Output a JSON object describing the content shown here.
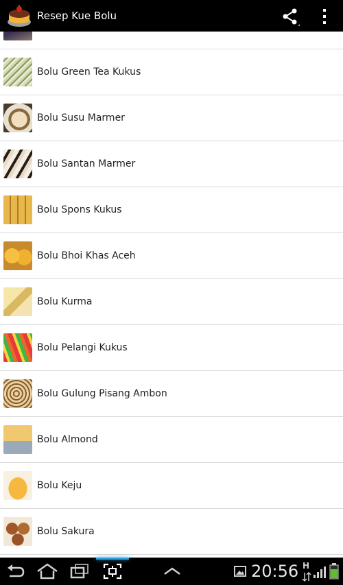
{
  "actionbar": {
    "title": "Resep Kue Bolu",
    "icons": {
      "app": "cake-icon",
      "share": "share-icon",
      "overflow": "more-vert-icon"
    }
  },
  "recipes": [
    {
      "label": "",
      "thumb": "partial-thumbnail"
    },
    {
      "label": "Bolu Green Tea Kukus"
    },
    {
      "label": "Bolu Susu Marmer"
    },
    {
      "label": "Bolu Santan Marmer"
    },
    {
      "label": "Bolu Spons Kukus"
    },
    {
      "label": "Bolu Bhoi Khas Aceh"
    },
    {
      "label": "Bolu Kurma"
    },
    {
      "label": "Bolu Pelangi Kukus"
    },
    {
      "label": "Bolu Gulung Pisang Ambon"
    },
    {
      "label": "Bolu Almond"
    },
    {
      "label": "Bolu Keju"
    },
    {
      "label": "Bolu Sakura"
    }
  ],
  "statusbar": {
    "time": "20:56",
    "network": "H",
    "icons": [
      "back-icon",
      "home-icon",
      "recent-apps-icon",
      "screenshot-icon",
      "menu-up-icon",
      "gallery-icon",
      "signal-icon",
      "battery-icon"
    ]
  },
  "colors": {
    "actionbar": "#000000",
    "divider": "#d9d9d9",
    "accent": "#2e9fd8"
  }
}
